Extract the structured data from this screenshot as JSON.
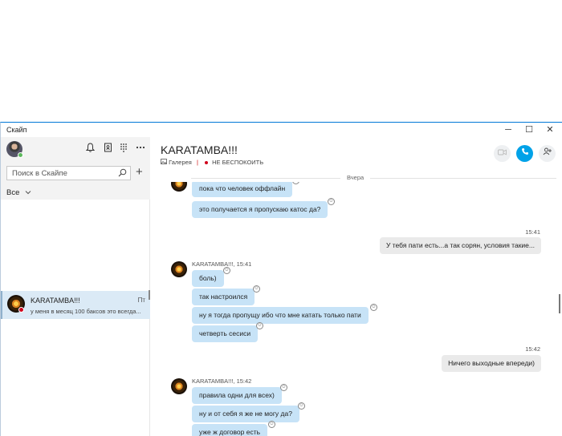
{
  "window": {
    "title": "Скайп",
    "minimize": "─",
    "maximize": "☐",
    "close": "✕"
  },
  "sidebar": {
    "icons": [
      "bell-icon",
      "contacts-book-icon",
      "dialpad-icon",
      "more-icon"
    ],
    "search": {
      "placeholder": "Поиск в Скайпе"
    },
    "add": "+",
    "filter": {
      "label": "Все",
      "chevron": "⌄"
    },
    "conversations": [
      {
        "name": "KARATAMBA!!!",
        "time": "Пт",
        "preview": "у меня в месяц 100 баксов это всегда..."
      }
    ]
  },
  "chat": {
    "title": "KARATAMBA!!!",
    "gallery": "Галерея",
    "status": "НЕ БЕСПОКОИТЬ",
    "day_separator": "Вчера",
    "messages": [
      {
        "kind": "in",
        "text": "пока что человек оффлайн"
      },
      {
        "kind": "in",
        "text": "это получается я пропускаю катос да?"
      },
      {
        "kind": "time_out",
        "text": "15:41"
      },
      {
        "kind": "out",
        "text": "У тебя пати есть...а так сорян, условия такие..."
      },
      {
        "kind": "sender",
        "text": "KARATAMBA!!!, 15:41"
      },
      {
        "kind": "in",
        "text": "боль)"
      },
      {
        "kind": "in",
        "text": "так настроился"
      },
      {
        "kind": "in",
        "text": "ну я тогда пропущу ибо что мне катать только пати"
      },
      {
        "kind": "in",
        "text": "четверть сесиси"
      },
      {
        "kind": "time_out",
        "text": "15:42"
      },
      {
        "kind": "out",
        "text": "Ничего выходные впереди)"
      },
      {
        "kind": "sender",
        "text": "KARATAMBA!!!, 15:42"
      },
      {
        "kind": "in",
        "text": "правила одни для всех)"
      },
      {
        "kind": "in",
        "text": "ну и от себя я же не могу да?"
      },
      {
        "kind": "in",
        "text": "уже ж договор есть"
      }
    ]
  },
  "colors": {
    "accent": "#0078d7",
    "call_button": "#00a2e8",
    "incoming_bubble": "#c7e3f7",
    "outgoing_bubble": "#eaeaea",
    "dnd": "#d0021b",
    "online": "#5cb85c"
  }
}
